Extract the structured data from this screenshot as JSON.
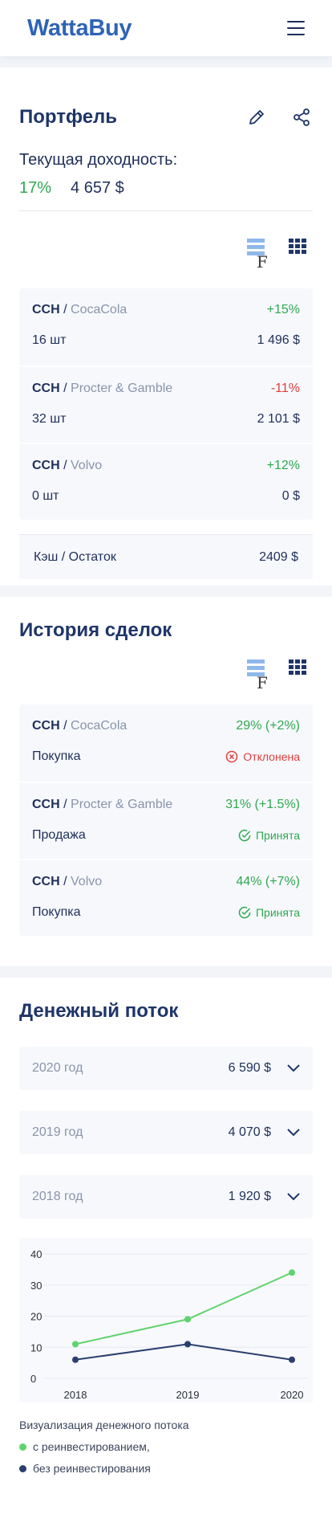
{
  "header": {
    "logo": "WattaBuy"
  },
  "portfolio": {
    "title": "Портфель",
    "yield_label": "Текущая доходность:",
    "yield_percent": "17%",
    "yield_amount": "4 657 $",
    "items": [
      {
        "ticker": "CCH",
        "company": "CocaCola",
        "change": "+15%",
        "qty": "16 шт",
        "amount": "1 496 $",
        "change_color": "#2fa94f"
      },
      {
        "ticker": "CCH",
        "company": "Procter & Gamble",
        "change": "-11%",
        "qty": "32 шт",
        "amount": "2 101 $",
        "change_color": "#e33d3d"
      },
      {
        "ticker": "CCH",
        "company": "Volvo",
        "change": "+12%",
        "qty": "0 шт",
        "amount": "0 $",
        "change_color": "#2fa94f"
      }
    ],
    "cash_label": "Кэш / Остаток",
    "cash_amount": "2409 $"
  },
  "history": {
    "title": "История сделок",
    "deals": [
      {
        "ticker": "CCH",
        "company": "CocaCola",
        "result": "29% (+2%)",
        "type": "Покупка",
        "status": "Отклонена",
        "status_kind": "rejected"
      },
      {
        "ticker": "CCH",
        "company": "Procter & Gamble",
        "result": "31% (+1.5%)",
        "type": "Продажа",
        "status": "Принята",
        "status_kind": "accepted"
      },
      {
        "ticker": "CCH",
        "company": "Volvo",
        "result": "44% (+7%)",
        "type": "Покупка",
        "status": "Принята",
        "status_kind": "accepted"
      }
    ]
  },
  "cashflow": {
    "title": "Денежный поток",
    "years": [
      {
        "label": "2020 год",
        "amount": "6 590 $"
      },
      {
        "label": "2019 год",
        "amount": "4 070 $"
      },
      {
        "label": "2018 год",
        "amount": "1 920 $"
      }
    ],
    "legend_title": "Визуализация денежного потока",
    "legend_reinvest": "с реинвестированием,",
    "legend_no_reinvest": "без реинвестирования"
  },
  "colors": {
    "brand": "#2f63b6",
    "positive": "#2fa94f",
    "negative": "#e33d3d",
    "dark": "#1f3569"
  },
  "chart_data": {
    "type": "line",
    "x": [
      "2018",
      "2019",
      "2020"
    ],
    "yticks": [
      "0",
      "10",
      "20",
      "30",
      "40"
    ],
    "ylim": [
      0,
      40
    ],
    "series": [
      {
        "values": [
          11,
          19,
          34
        ],
        "color": "#5fd36d"
      },
      {
        "values": [
          6,
          11,
          6
        ],
        "color": "#2a3f6e"
      }
    ]
  }
}
